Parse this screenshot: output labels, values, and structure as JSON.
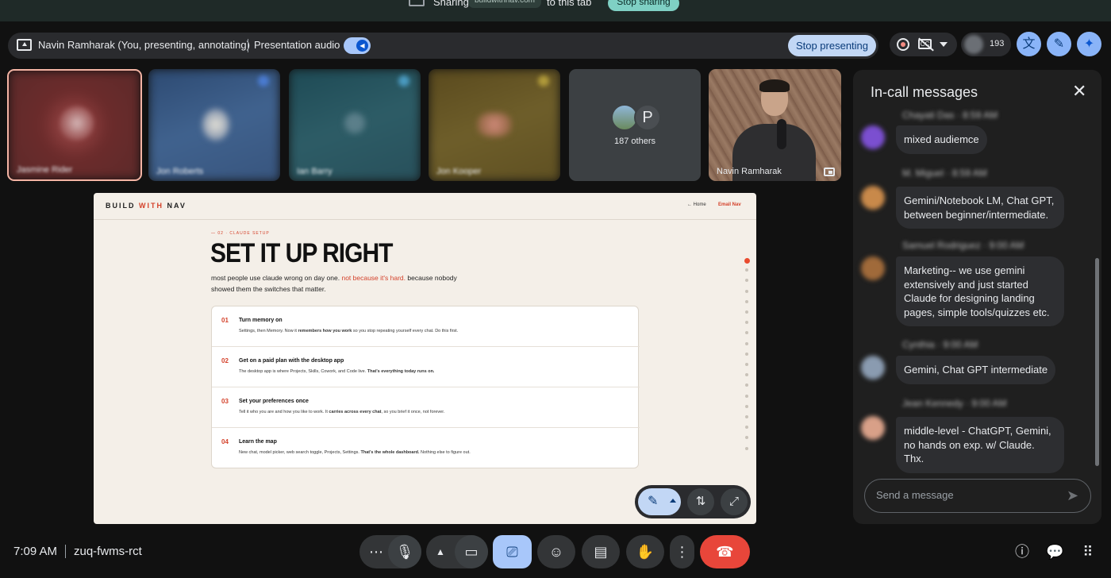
{
  "share_bar": {
    "sharing_label": "Sharing",
    "domain": "buildwithnav.com",
    "to_tab_label": "to this tab",
    "stop_sharing_label": "Stop sharing"
  },
  "presenting_bar": {
    "presenter_text": "Navin Ramharak (You, presenting, annotating)",
    "audio_label": "Presentation audio",
    "stop_presenting_label": "Stop presenting"
  },
  "top_right": {
    "participant_count": "193"
  },
  "tiles": {
    "others_label": "187 others",
    "others_avatar_letter": "P",
    "self_name": "Navin Ramharak",
    "blurred_names": [
      "Jasmine Rider",
      "Jon Roberts",
      "Ian Barry",
      "Jon Kooper"
    ]
  },
  "slide": {
    "logo": {
      "a": "BUILD",
      "b": "WITH",
      "c": "NAV"
    },
    "home_link": "← Home",
    "email_link": "Email Nav",
    "kicker": "— 02 · CLAUDE SETUP",
    "title": "SET IT UP RIGHT",
    "intro_a": "most people use claude wrong on day one.",
    "intro_red": "not because it's hard.",
    "intro_b": "because nobody showed them the switches that matter.",
    "steps": [
      {
        "num": "01",
        "title": "Turn memory on",
        "desc_a": "Settings, then Memory. Now it ",
        "desc_b": "remembers how you work",
        "desc_c": " so you stop repeating yourself every chat. Do this first."
      },
      {
        "num": "02",
        "title": "Get on a paid plan with the desktop app",
        "desc_a": "The desktop app is where Projects, Skills, Cowork, and Code live. ",
        "desc_b": "That's everything today runs on.",
        "desc_c": ""
      },
      {
        "num": "03",
        "title": "Set your preferences once",
        "desc_a": "Tell it who you are and how you like to work. It ",
        "desc_b": "carries across every chat",
        "desc_c": ", so you brief it once, not forever."
      },
      {
        "num": "04",
        "title": "Learn the map",
        "desc_a": "New chat, model picker, web search toggle, Projects, Settings. ",
        "desc_b": "That's the whole dashboard.",
        "desc_c": " Nothing else to figure out."
      }
    ]
  },
  "chat": {
    "title": "In-call messages",
    "messages": [
      {
        "sender": "Chayati Das",
        "time": "8:59 AM",
        "text": "mixed audiemce",
        "color": "#7b4fd0"
      },
      {
        "sender": "M. Miguel",
        "time": "8:59 AM",
        "text": "Gemini/Notebook LM, Chat GPT, between beginner/intermediate.",
        "color": "#c8894a"
      },
      {
        "sender": "Samuel Rodriguez",
        "time": "9:00 AM",
        "text": "Marketing-- we use gemini extensively and just started Claude for designing landing pages, simple tools/quizzes etc.",
        "color": "#a06a3a"
      },
      {
        "sender": "Cynthia",
        "time": "9:00 AM",
        "text": "Gemini, Chat GPT intermediate",
        "color": "#8a9bb0"
      },
      {
        "sender": "Jean Kennedy",
        "time": "9:00 AM",
        "text": "middle-level - ChatGPT, Gemini, no hands on exp. w/ Claude.  Thx.",
        "color": "#d8a088"
      }
    ],
    "input_placeholder": "Send a message"
  },
  "bottom": {
    "time": "7:09 AM",
    "meeting_code": "zuq-fwms-rct"
  },
  "colors": {
    "accent_blue": "#8ab4f8",
    "end_call_red": "#e8463a",
    "slide_accent": "#d4412a"
  }
}
